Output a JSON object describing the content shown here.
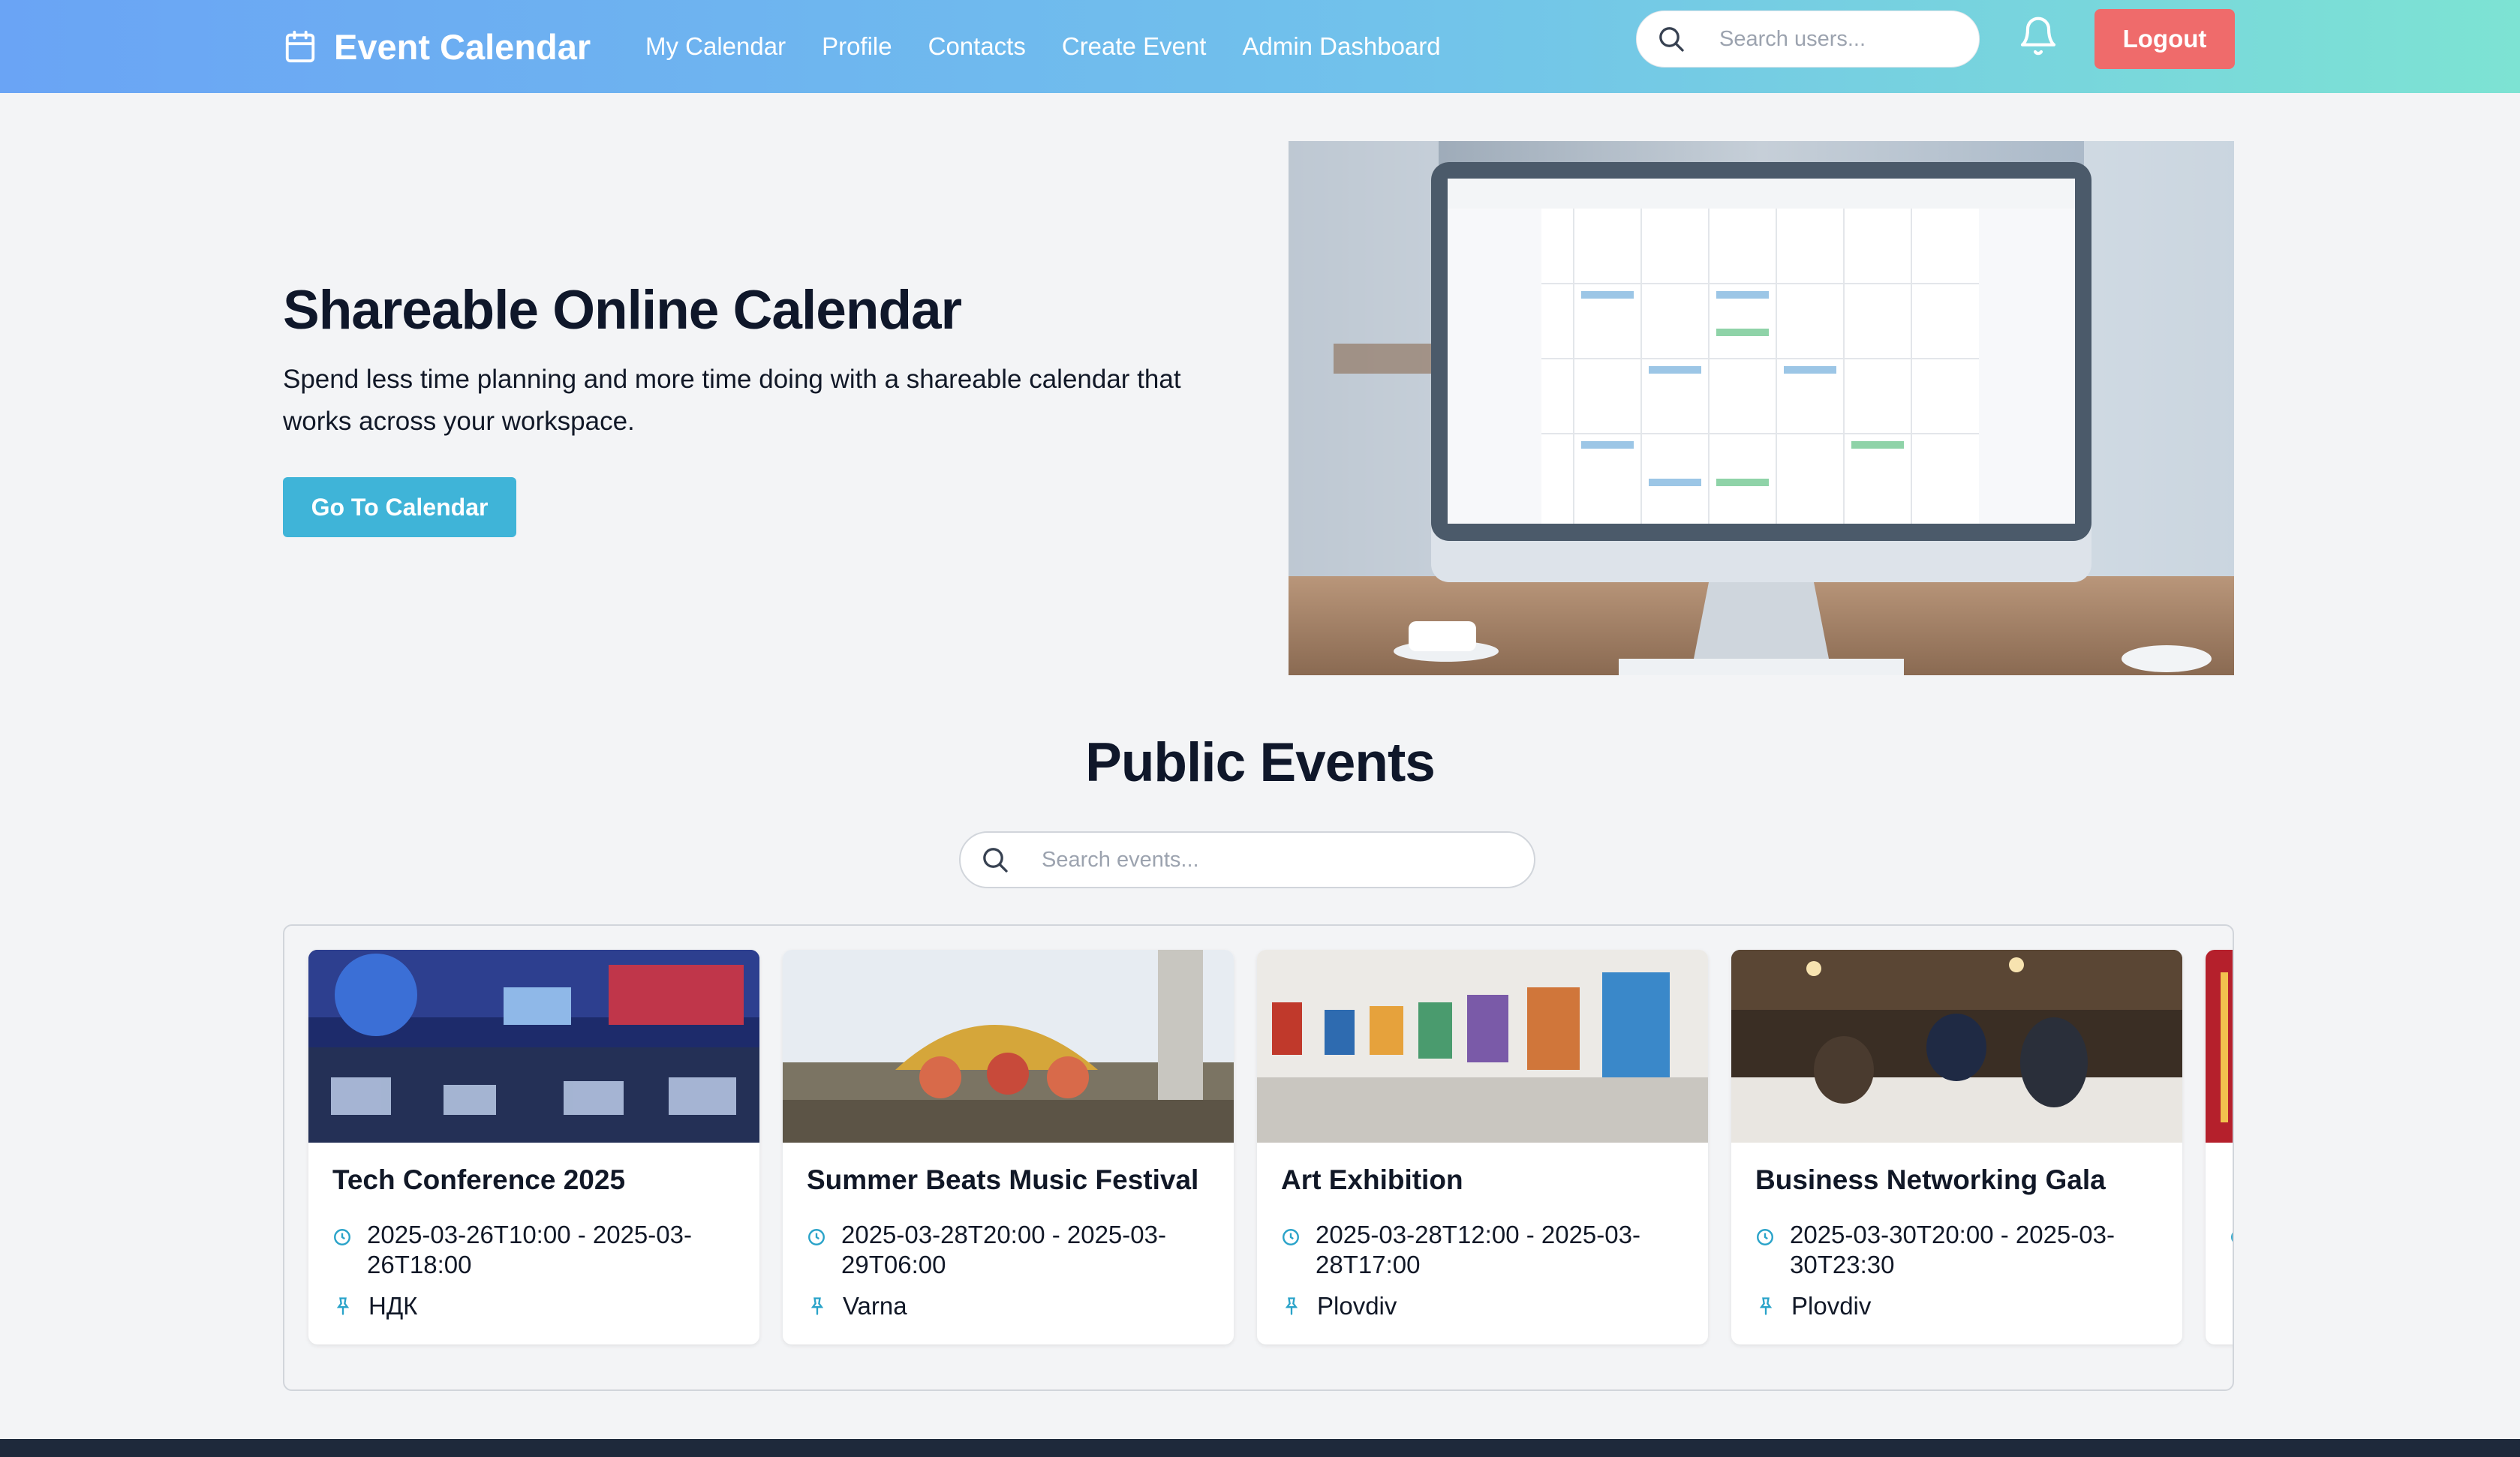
{
  "nav": {
    "brand": "Event Calendar",
    "links": [
      "My Calendar",
      "Profile",
      "Contacts",
      "Create Event",
      "Admin Dashboard"
    ],
    "user_search_placeholder": "Search users...",
    "logout_label": "Logout",
    "icons": {
      "brand": "calendar-icon",
      "search": "search-icon",
      "notifications": "bell-icon"
    }
  },
  "hero": {
    "title": "Shareable Online Calendar",
    "subtitle": "Spend less time planning and more time doing with a shareable calendar that works across your workspace.",
    "cta_label": "Go To Calendar"
  },
  "events_section": {
    "title": "Public Events",
    "search_placeholder": "Search events...",
    "events": [
      {
        "title": "Tech Conference 2025",
        "time": "2025-03-26T10:00 - 2025-03-26T18:00",
        "location": "НДК"
      },
      {
        "title": "Summer Beats Music Festival",
        "time": "2025-03-28T20:00 - 2025-03-29T06:00",
        "location": "Varna"
      },
      {
        "title": "Art Exhibition",
        "time": "2025-03-28T12:00 - 2025-03-28T17:00",
        "location": "Plovdiv"
      },
      {
        "title": "Business Networking Gala",
        "time": "2025-03-30T20:00 - 2025-03-30T23:30",
        "location": "Plovdiv"
      }
    ]
  },
  "colors": {
    "nav_gradient_start": "#6aa4f5",
    "nav_gradient_end": "#7de3d3",
    "logout": "#ef6b6b",
    "cta": "#3fb4d8",
    "icon_accent": "#2aa3c9"
  }
}
